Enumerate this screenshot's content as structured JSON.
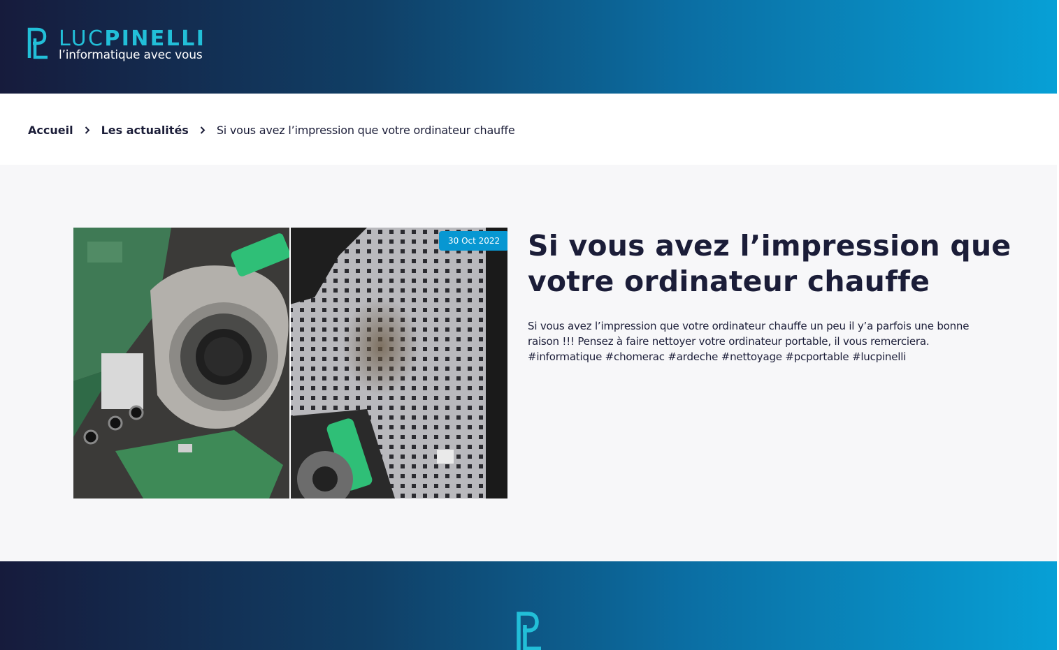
{
  "header": {
    "brand_light": "LUC",
    "brand_bold": "PINELLI",
    "tagline": "l’informatique avec vous",
    "logo_icon": "pl-monogram-icon"
  },
  "breadcrumb": {
    "items": [
      "Accueil",
      "Les actualités"
    ],
    "current": "Si vous avez l’impression que votre ordinateur chauffe",
    "separator_icon": "chevron-right-icon"
  },
  "post": {
    "date": "30 Oct 2022",
    "title": "Si vous avez l’impression que votre ordinateur chauffe",
    "body": "Si vous avez l’impression que votre ordinateur chauffe un peu il y’a parfois une bonne raison !!! Pensez à faire nettoyer votre ordinateur portable, il vous remerciera. #informatique #chomerac #ardeche #nettoyage #pcportable #lucpinelli",
    "image_icon": "laptop-cleaning-photo"
  },
  "footer": {
    "logo_icon": "pl-monogram-icon"
  },
  "colors": {
    "brand_teal": "#22bfd8",
    "dark_navy": "#161b3c",
    "accent_blue": "#0797d2",
    "text_dark": "#1b1d38",
    "section_bg": "#f7f7f9"
  }
}
